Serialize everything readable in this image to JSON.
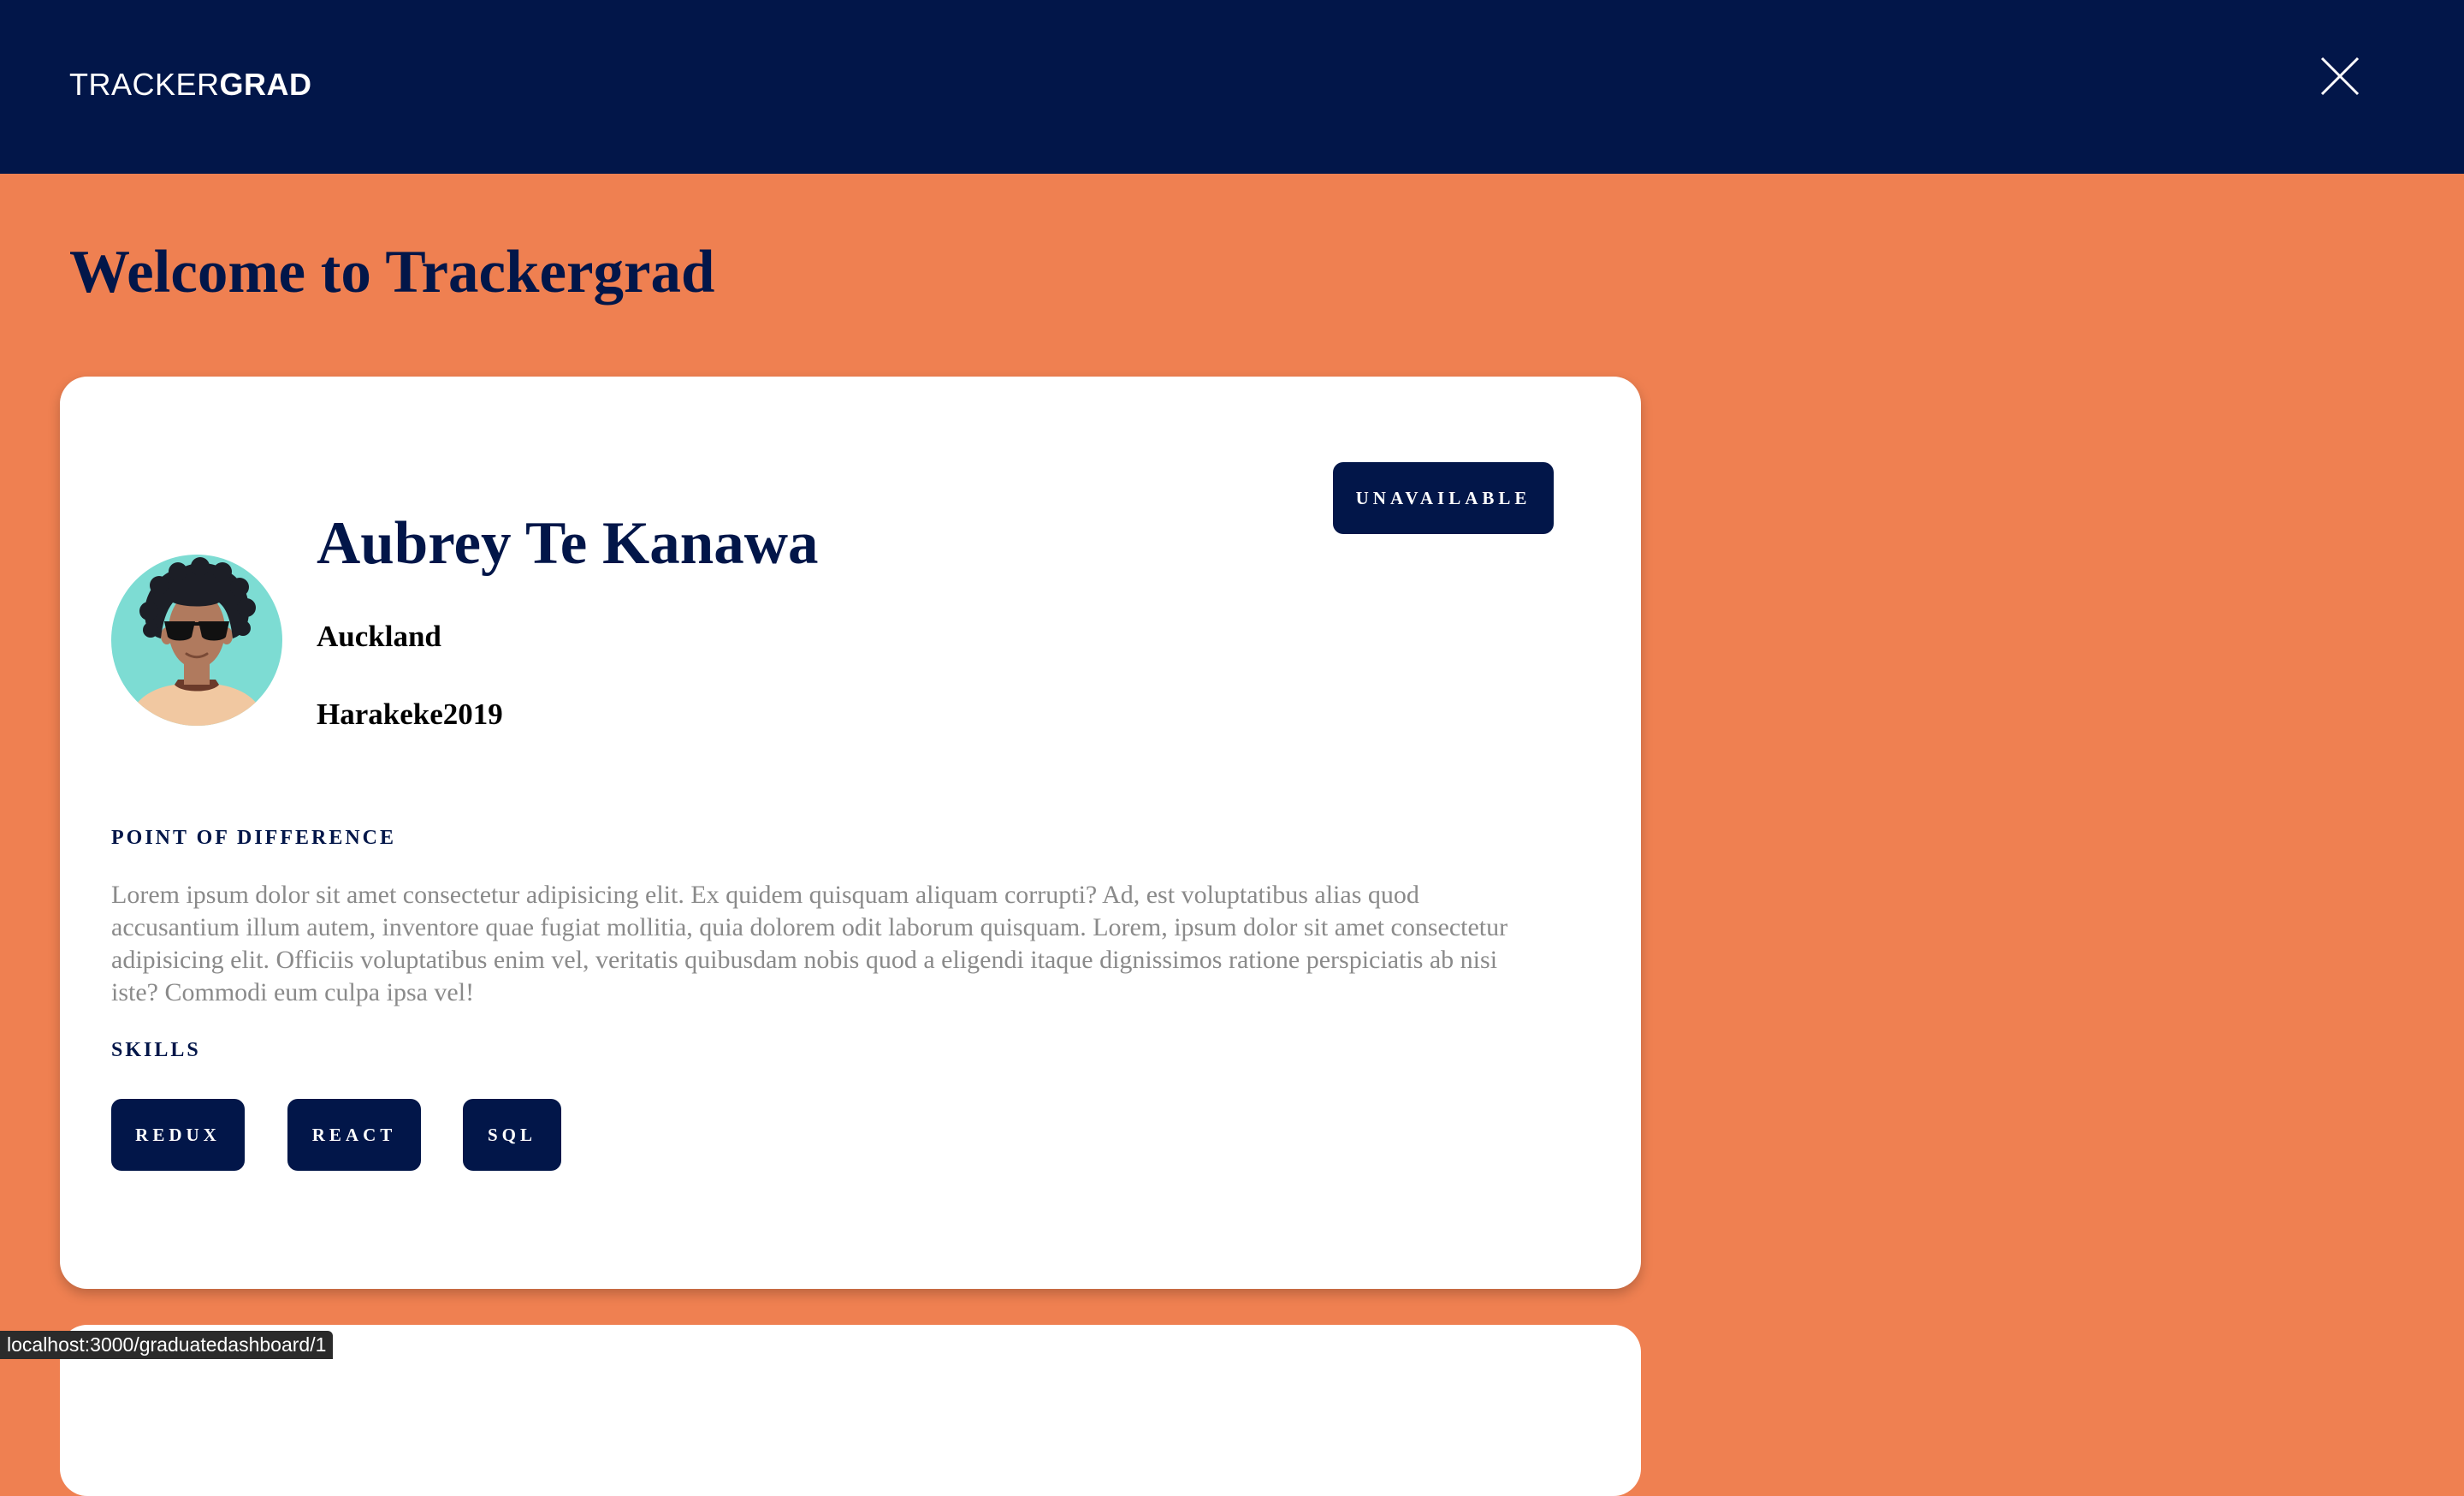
{
  "header": {
    "logo_light": "TRACKER",
    "logo_bold": "GRAD",
    "close_icon": "close-icon"
  },
  "page": {
    "title": "Welcome to Trackergrad"
  },
  "profile": {
    "name": "Aubrey Te Kanawa",
    "location": "Auckland",
    "cohort": "Harakeke2019",
    "status_label": "UNAVAILABLE",
    "avatar_icon": "avatar",
    "point_of_difference_label": "POINT OF DIFFERENCE",
    "point_of_difference_text": "Lorem ipsum dolor sit amet consectetur adipisicing elit. Ex quidem quisquam aliquam corrupti? Ad, est voluptatibus alias quod accusantium illum autem, inventore quae fugiat mollitia, quia dolorem odit laborum quisquam. Lorem, ipsum dolor sit amet consectetur adipisicing elit. Officiis voluptatibus enim vel, veritatis quibusdam nobis quod a eligendi itaque dignissimos ratione perspiciatis ab nisi iste? Commodi eum culpa ipsa vel!",
    "skills_label": "SKILLS",
    "skills": [
      "REDUX",
      "REACT",
      "SQL"
    ]
  },
  "browser": {
    "status_url": "localhost:3000/graduatedashboard/1"
  },
  "colors": {
    "navy": "#021649",
    "orange": "#EF8051",
    "white": "#FFFFFF",
    "avatar_bg": "#7DDCD3"
  }
}
